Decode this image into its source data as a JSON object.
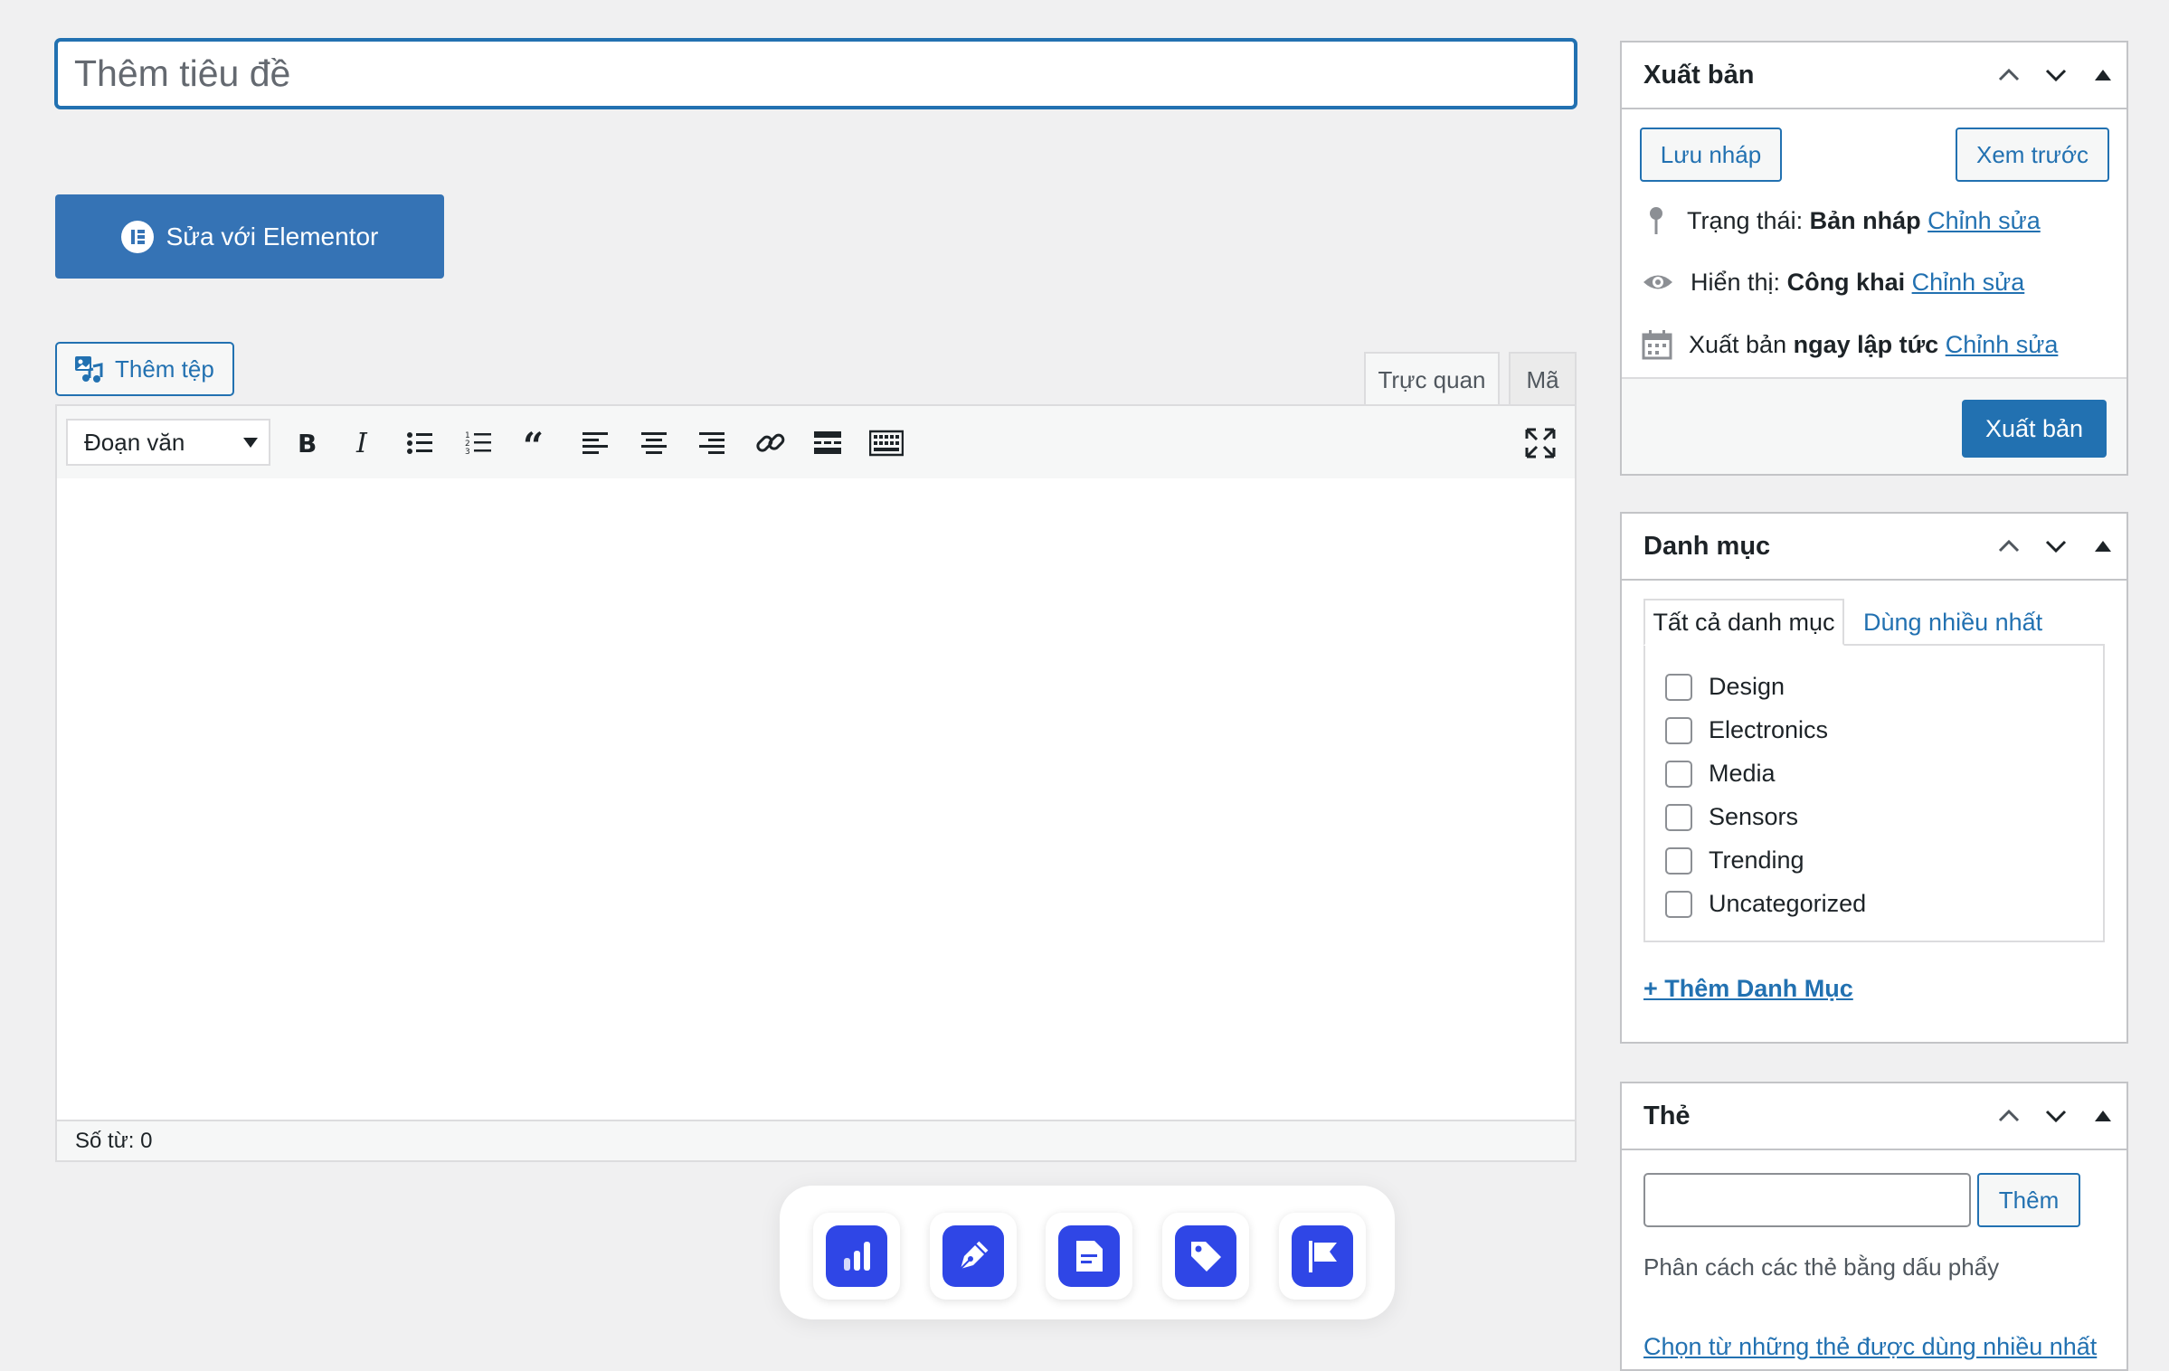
{
  "title": {
    "placeholder": "Thêm tiêu đề"
  },
  "elementor": {
    "label": "Sửa với Elementor"
  },
  "editor": {
    "add_media_label": "Thêm tệp",
    "tabs": {
      "visual": "Trực quan",
      "code": "Mã"
    },
    "format_select": "Đoạn văn",
    "toolbar_icons": [
      "bold-icon",
      "italic-icon",
      "bullet-list-icon",
      "numbered-list-icon",
      "blockquote-icon",
      "align-left-icon",
      "align-center-icon",
      "align-right-icon",
      "link-icon",
      "read-more-icon",
      "toolbar-toggle-icon",
      "fullscreen-icon"
    ],
    "word_count": "Số từ: 0"
  },
  "dock": {
    "icons": [
      "analytics-icon",
      "pen-icon",
      "document-icon",
      "tag-icon",
      "flag-icon"
    ],
    "accent": "#2f46e6"
  },
  "publish": {
    "title": "Xuất bản",
    "save_draft": "Lưu nháp",
    "preview": "Xem trước",
    "status_label": "Trạng thái:",
    "status_value": "Bản nháp",
    "visibility_label": "Hiển thị:",
    "visibility_value": "Công khai",
    "schedule_label": "Xuất bản",
    "schedule_value": "ngay lập tức",
    "edit_link": "Chỉnh sửa",
    "publish_button": "Xuất bản"
  },
  "categories": {
    "title": "Danh mục",
    "tab_all": "Tất cả danh mục",
    "tab_popular": "Dùng nhiều nhất",
    "items": [
      "Design",
      "Electronics",
      "Media",
      "Sensors",
      "Trending",
      "Uncategorized"
    ],
    "add_link": "+ Thêm Danh Mục"
  },
  "tags": {
    "title": "Thẻ",
    "add_button": "Thêm",
    "hint": "Phân cách các thẻ bằng dấu phẩy",
    "choose_link": "Chọn từ những thẻ được dùng nhiều nhất"
  },
  "colors": {
    "primary": "#2271b1",
    "elementor": "#3573b5",
    "border": "#c3c4c7"
  }
}
